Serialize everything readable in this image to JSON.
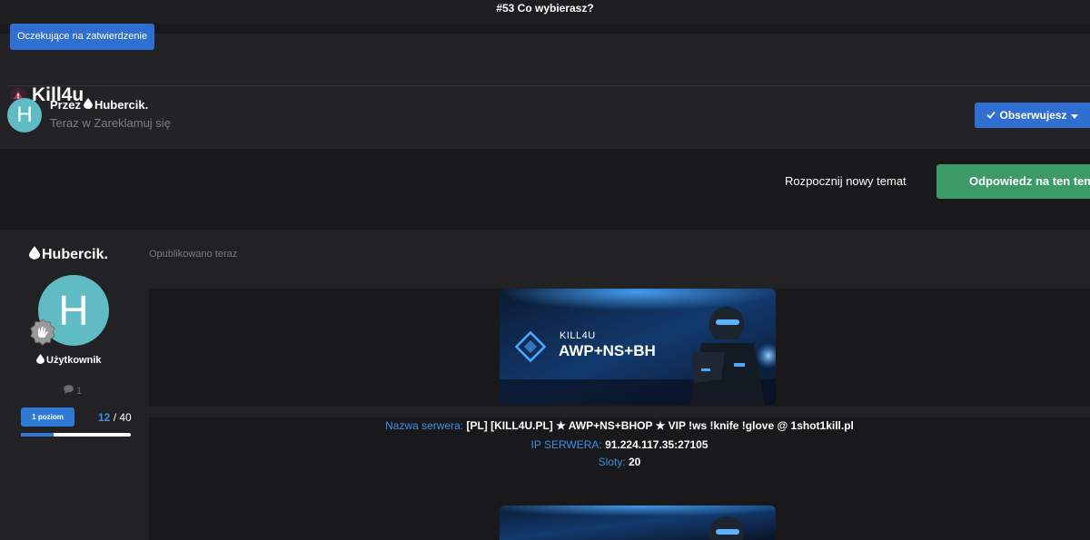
{
  "top_title": "#53 Co wybierasz?",
  "pending_badge": "Oczekujące na zatwierdzenie",
  "topic_title": "Kill4u",
  "author": {
    "avatar_letter": "H",
    "by_prefix": "Przez",
    "name": "Hubercik.",
    "subline": "Teraz w Zareklamuj się"
  },
  "follow_button": "Obserwujesz",
  "actions": {
    "new_topic": "Rozpocznij nowy temat",
    "reply": "Odpowiedz na ten temat"
  },
  "post": {
    "user_name": "Hubercik.",
    "avatar_letter": "H",
    "user_rank": "Użytkownik",
    "post_count": "1",
    "level_label": "1 poziom",
    "xp_current": "12",
    "xp_sep": " / ",
    "xp_max": "40",
    "xp_progress": 0.3,
    "published": "Opublikowano teraz",
    "banner_brand": "KILL4U",
    "banner_mode": "AWP+NS+BH",
    "info": [
      {
        "label": "Nazwa serwera:",
        "value": " [PL] [KILL4U.PL] ★ AWP+NS+BHOP ★ VIP !ws !knife !glove @ 1shot1kill.pl"
      },
      {
        "label": "IP SERWERA:",
        "value": " 91.224.117.35:27105"
      },
      {
        "label": "Sloty:",
        "value": " 20"
      }
    ]
  },
  "colors": {
    "accent_blue": "#2f6fd2",
    "reply_green": "#3b9a68",
    "avatar_teal": "#5fbcc4"
  }
}
